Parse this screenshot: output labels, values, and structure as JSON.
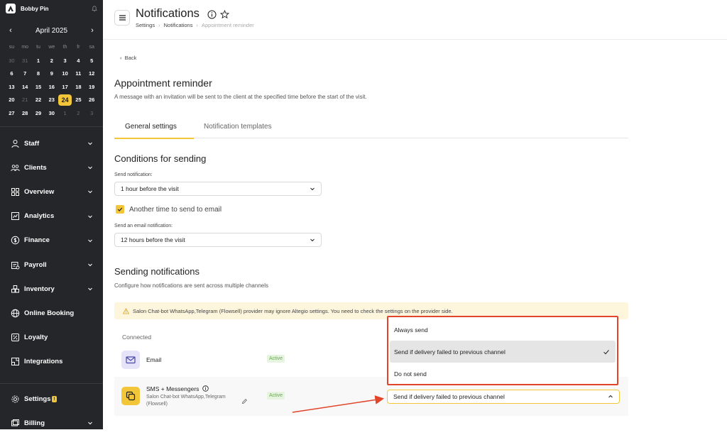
{
  "sidebar": {
    "user": "Bobby Pin",
    "calendar": {
      "month": "April 2025",
      "days_of_week": [
        "su",
        "mo",
        "tu",
        "we",
        "th",
        "fr",
        "sa"
      ],
      "weeks": [
        [
          "30",
          "31",
          "1",
          "2",
          "3",
          "4",
          "5"
        ],
        [
          "6",
          "7",
          "8",
          "9",
          "10",
          "11",
          "12"
        ],
        [
          "13",
          "14",
          "15",
          "16",
          "17",
          "18",
          "19"
        ],
        [
          "20",
          "21",
          "22",
          "23",
          "24",
          "25",
          "26"
        ],
        [
          "27",
          "28",
          "29",
          "30",
          "1",
          "2",
          "3"
        ]
      ],
      "selected": "24"
    },
    "nav": [
      {
        "label": "Staff",
        "icon": "person-icon"
      },
      {
        "label": "Clients",
        "icon": "clients-icon"
      },
      {
        "label": "Overview",
        "icon": "grid-icon"
      },
      {
        "label": "Analytics",
        "icon": "chart-icon"
      },
      {
        "label": "Finance",
        "icon": "dollar-icon"
      },
      {
        "label": "Payroll",
        "icon": "payroll-icon"
      },
      {
        "label": "Inventory",
        "icon": "inventory-icon"
      },
      {
        "label": "Online Booking",
        "icon": "globe-icon"
      },
      {
        "label": "Loyalty",
        "icon": "loyalty-icon"
      },
      {
        "label": "Integrations",
        "icon": "integrations-icon"
      }
    ],
    "settings_label": "Settings",
    "settings_badge": "!",
    "billing_label": "Billing"
  },
  "header": {
    "title": "Notifications",
    "breadcrumbs": [
      "Settings",
      "Notifications",
      "Appointment reminder"
    ]
  },
  "main": {
    "back": "Back",
    "title": "Appointment reminder",
    "description": "A message with an invitation will be sent to the client at the specified time before the start of the visit.",
    "tabs": [
      "General settings",
      "Notification templates"
    ],
    "conditions": {
      "heading": "Conditions for sending",
      "send_label": "Send notification:",
      "send_value": "1 hour before the visit",
      "checkbox_label": "Another time to send to email",
      "email_label": "Send an email notification:",
      "email_value": "12 hours before the visit"
    },
    "sending": {
      "heading": "Sending notifications",
      "subtitle": "Configure how notifications are sent across multiple channels",
      "warning": "Salon Chat-bot WhatsApp,Telegram (Flowsell) provider may ignore Altegio settings. You need to check the settings on the provider side.",
      "connected_label": "Connected",
      "channels": [
        {
          "name": "Email",
          "status": "Active"
        },
        {
          "name": "SMS + Messengers",
          "sub": "Salon Chat-bot WhatsApp,Telegram (Flowsell)",
          "status": "Active",
          "mode": "Send if delivery failed to previous channel"
        }
      ]
    },
    "dropdown": {
      "options": [
        "Always send",
        "Send if delivery failed to previous channel",
        "Do not send"
      ],
      "selected_index": 1
    }
  },
  "colors": {
    "sidebar_bg": "#252629",
    "accent": "#f3c639",
    "annotation": "#e2452b",
    "active_green": "#6aa84f"
  }
}
